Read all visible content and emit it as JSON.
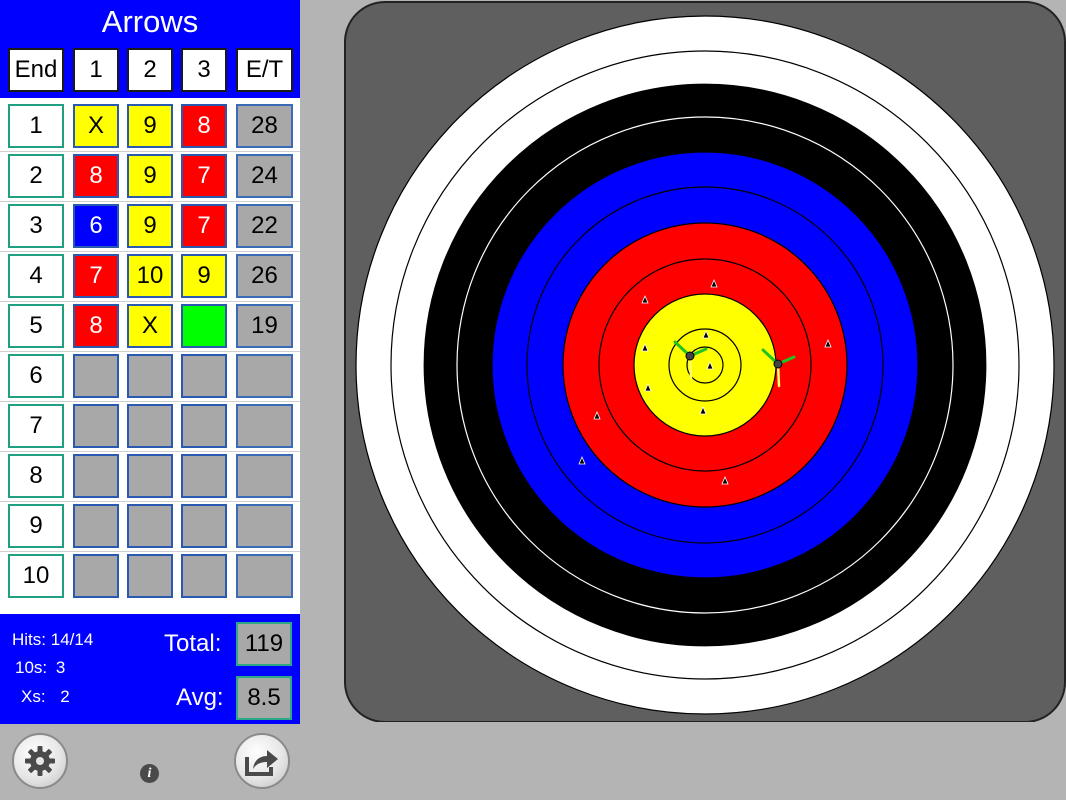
{
  "panel": {
    "title": "Arrows",
    "headers": [
      "End",
      "1",
      "2",
      "3",
      "E/T"
    ]
  },
  "ends": [
    {
      "end": "1",
      "arrows": [
        "X",
        "9",
        "8"
      ],
      "total": "28"
    },
    {
      "end": "2",
      "arrows": [
        "8",
        "9",
        "7"
      ],
      "total": "24"
    },
    {
      "end": "3",
      "arrows": [
        "6",
        "9",
        "7"
      ],
      "total": "22"
    },
    {
      "end": "4",
      "arrows": [
        "7",
        "10",
        "9"
      ],
      "total": "26"
    },
    {
      "end": "5",
      "arrows": [
        "8",
        "X",
        ""
      ],
      "total": "19"
    },
    {
      "end": "6",
      "arrows": [
        "",
        "",
        ""
      ],
      "total": ""
    },
    {
      "end": "7",
      "arrows": [
        "",
        "",
        ""
      ],
      "total": ""
    },
    {
      "end": "8",
      "arrows": [
        "",
        "",
        ""
      ],
      "total": ""
    },
    {
      "end": "9",
      "arrows": [
        "",
        "",
        ""
      ],
      "total": ""
    },
    {
      "end": "10",
      "arrows": [
        "",
        "",
        ""
      ],
      "total": ""
    }
  ],
  "stats": {
    "hits_label": "Hits:",
    "hits_value": "14/14",
    "tens_label": "10s:",
    "tens_value": "3",
    "xs_label": "Xs:",
    "xs_value": "2",
    "total_label": "Total:",
    "total_value": "119",
    "avg_label": "Avg:",
    "avg_value": "8.5"
  },
  "score_colors": {
    "X": "#ffff00",
    "10": "#ffff00",
    "9": "#ffff00",
    "8": "#ff0000",
    "7": "#ff0000",
    "6": "#0000ff",
    "5": "#0000ff",
    "active": "#00ff00",
    "empty": "#a8a8a8"
  },
  "icons": {
    "settings": "gear-icon",
    "share": "share-arrow-icon",
    "info": "info-icon"
  },
  "info_glyph": "i",
  "colors": {
    "panel_bg": "#0000ff",
    "target_bg": "#5f5f5f",
    "ring_white": "#ffffff",
    "ring_black": "#000000",
    "ring_blue": "#0000ff",
    "ring_red": "#ff0000",
    "ring_gold": "#ffff00"
  }
}
